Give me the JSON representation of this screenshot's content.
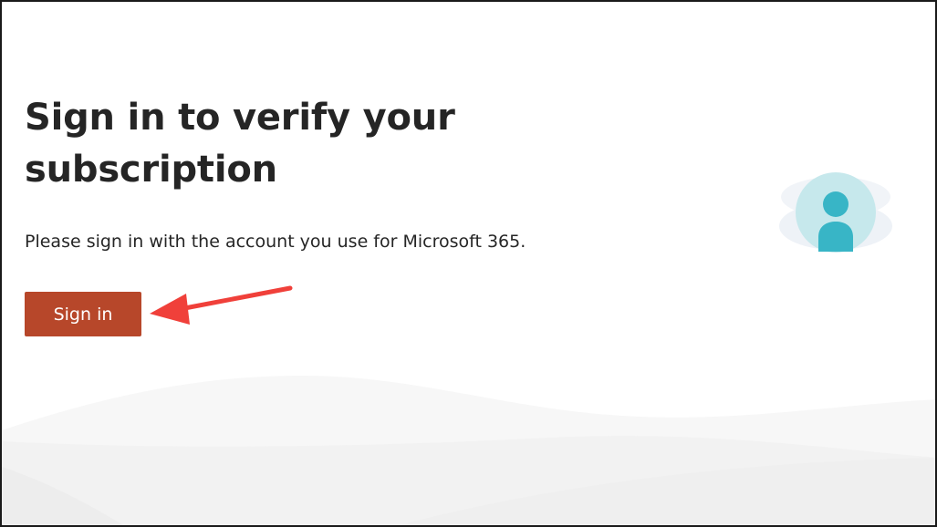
{
  "page": {
    "title": "Sign in to verify your subscription",
    "subtitle": "Please sign in with the account you use for Microsoft 365.",
    "signin_button_label": "Sign in"
  },
  "illustration": {
    "icon": "user-avatar-icon",
    "accent_color": "#38b5c6",
    "circle_color": "#c6e8ec"
  },
  "annotation": {
    "icon": "red-arrow-icon",
    "color": "#f0403a"
  },
  "colors": {
    "button": "#b7472a",
    "text": "#252525"
  }
}
